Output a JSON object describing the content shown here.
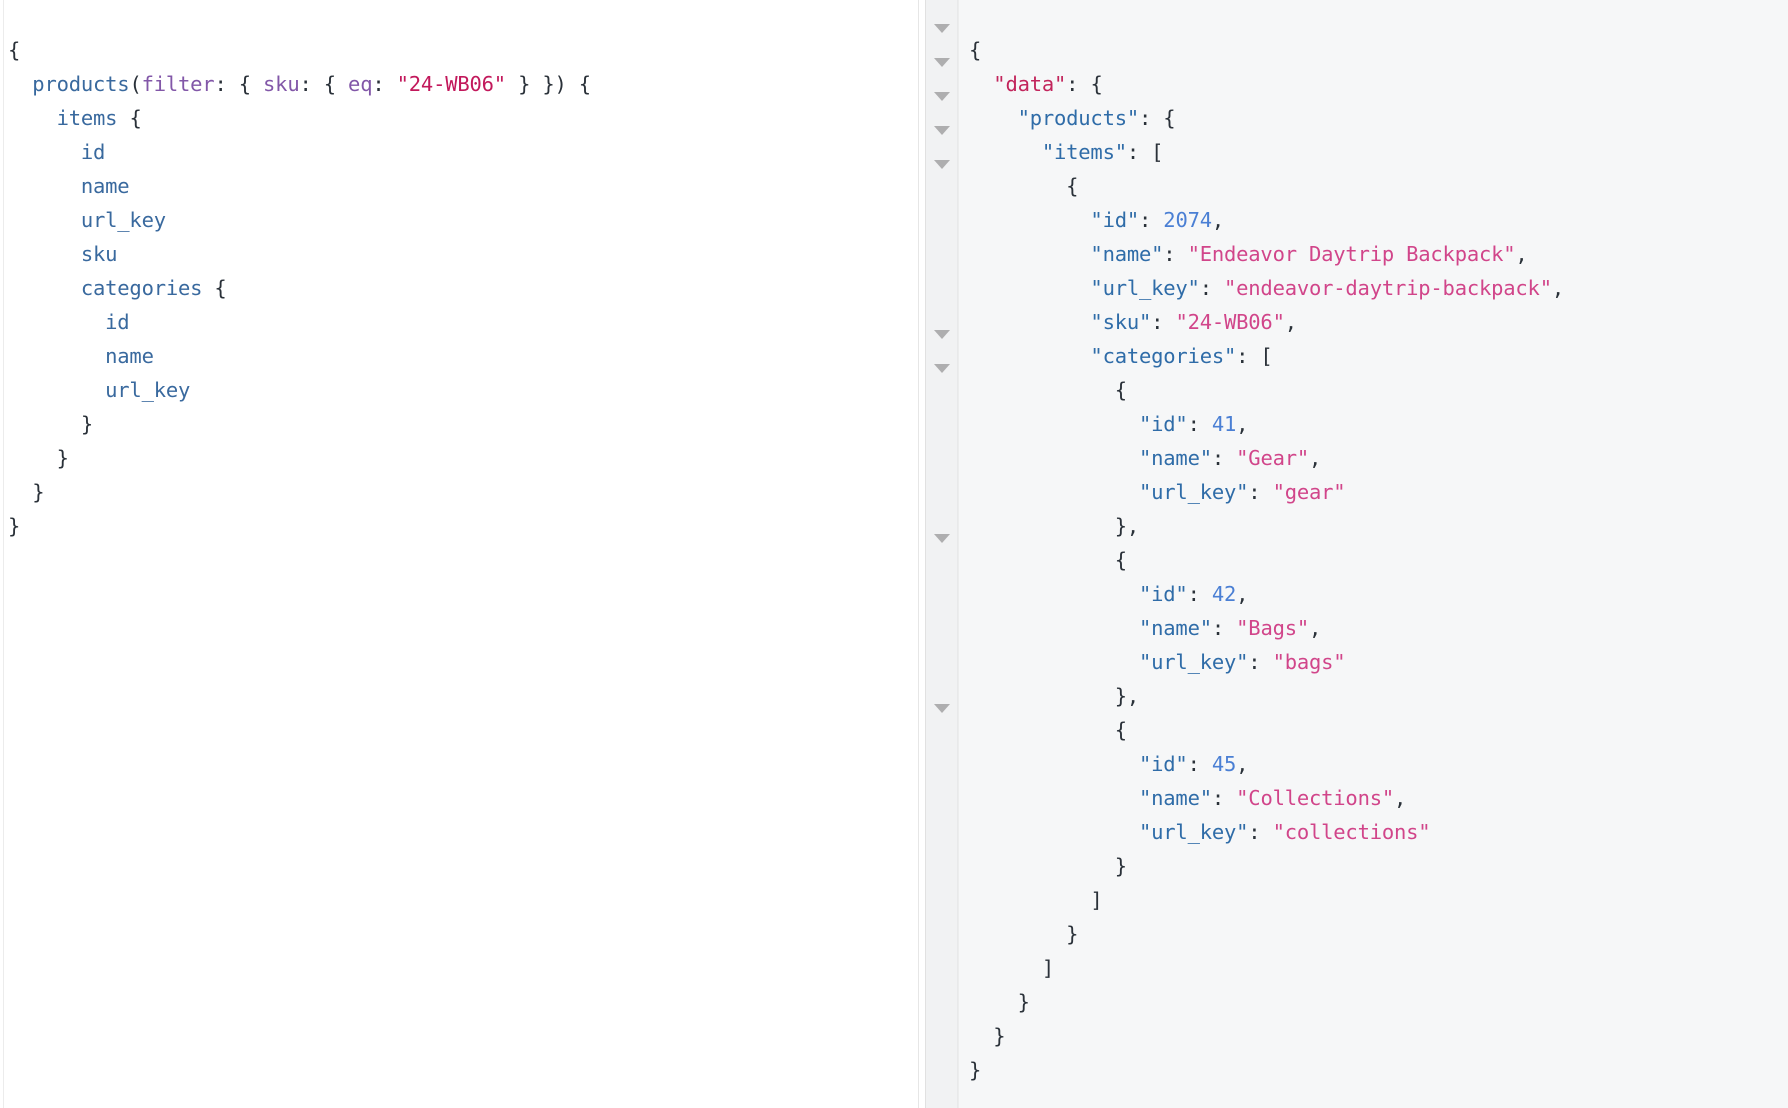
{
  "editor": {
    "name": "graphql-query-editor",
    "language": "graphql",
    "font_size_px": 20,
    "line_height_px": 34,
    "colors": {
      "punctuation": "#2a3139",
      "field": "#39699e",
      "argument": "#8257a8",
      "string": "#c2185b",
      "background": "#ffffff"
    },
    "query_text": "{\n  products(filter: { sku: { eq: \"24-WB06\" } }) {\n    items {\n      id\n      name\n      url_key\n      sku\n      categories {\n        id\n        name\n        url_key\n      }\n    }\n  }\n}",
    "lines": [
      {
        "indent": 0,
        "tokens": [
          {
            "t": "{",
            "c": "punc"
          }
        ]
      },
      {
        "indent": 1,
        "tokens": [
          {
            "t": "products",
            "c": "field"
          },
          {
            "t": "(",
            "c": "punc"
          },
          {
            "t": "filter",
            "c": "arg"
          },
          {
            "t": ": { ",
            "c": "punc"
          },
          {
            "t": "sku",
            "c": "arg"
          },
          {
            "t": ": { ",
            "c": "punc"
          },
          {
            "t": "eq",
            "c": "arg"
          },
          {
            "t": ": ",
            "c": "punc"
          },
          {
            "t": "\"24-WB06\"",
            "c": "str"
          },
          {
            "t": " } }) {",
            "c": "punc"
          }
        ]
      },
      {
        "indent": 2,
        "tokens": [
          {
            "t": "items",
            "c": "field"
          },
          {
            "t": " {",
            "c": "punc"
          }
        ]
      },
      {
        "indent": 3,
        "tokens": [
          {
            "t": "id",
            "c": "field"
          }
        ]
      },
      {
        "indent": 3,
        "tokens": [
          {
            "t": "name",
            "c": "field"
          }
        ]
      },
      {
        "indent": 3,
        "tokens": [
          {
            "t": "url_key",
            "c": "field"
          }
        ]
      },
      {
        "indent": 3,
        "tokens": [
          {
            "t": "sku",
            "c": "field"
          }
        ]
      },
      {
        "indent": 3,
        "tokens": [
          {
            "t": "categories",
            "c": "field"
          },
          {
            "t": " {",
            "c": "punc"
          }
        ]
      },
      {
        "indent": 4,
        "tokens": [
          {
            "t": "id",
            "c": "field"
          }
        ]
      },
      {
        "indent": 4,
        "tokens": [
          {
            "t": "name",
            "c": "field"
          }
        ]
      },
      {
        "indent": 4,
        "tokens": [
          {
            "t": "url_key",
            "c": "field"
          }
        ]
      },
      {
        "indent": 3,
        "tokens": [
          {
            "t": "}",
            "c": "punc"
          }
        ]
      },
      {
        "indent": 2,
        "tokens": [
          {
            "t": "}",
            "c": "punc"
          }
        ]
      },
      {
        "indent": 1,
        "tokens": [
          {
            "t": "}",
            "c": "punc"
          }
        ]
      },
      {
        "indent": 0,
        "tokens": [
          {
            "t": "}",
            "c": "punc"
          }
        ]
      }
    ]
  },
  "result": {
    "name": "graphql-response-viewer",
    "language": "json",
    "colors": {
      "punctuation": "#2a3139",
      "root_key": "#c2255c",
      "key": "#2f6ca8",
      "string": "#d1458a",
      "number": "#4a7fd4",
      "background": "#f6f7f8",
      "gutter_background": "#f1f2f3",
      "fold_arrow": "#9b9b9b"
    },
    "response_json": {
      "data": {
        "products": {
          "items": [
            {
              "id": 2074,
              "name": "Endeavor Daytrip Backpack",
              "url_key": "endeavor-daytrip-backpack",
              "sku": "24-WB06",
              "categories": [
                {
                  "id": 41,
                  "name": "Gear",
                  "url_key": "gear"
                },
                {
                  "id": 42,
                  "name": "Bags",
                  "url_key": "bags"
                },
                {
                  "id": 45,
                  "name": "Collections",
                  "url_key": "collections"
                }
              ]
            }
          ]
        }
      }
    },
    "fold_arrows": [
      {
        "name": "fold-arrow-root",
        "line": 0,
        "state": "expanded"
      },
      {
        "name": "fold-arrow-data",
        "line": 1,
        "state": "expanded"
      },
      {
        "name": "fold-arrow-products",
        "line": 2,
        "state": "expanded"
      },
      {
        "name": "fold-arrow-items",
        "line": 3,
        "state": "expanded"
      },
      {
        "name": "fold-arrow-item-0",
        "line": 4,
        "state": "expanded"
      },
      {
        "name": "fold-arrow-categories",
        "line": 9,
        "state": "expanded"
      },
      {
        "name": "fold-arrow-category-0",
        "line": 10,
        "state": "expanded"
      },
      {
        "name": "fold-arrow-category-1",
        "line": 15,
        "state": "expanded"
      },
      {
        "name": "fold-arrow-category-2",
        "line": 20,
        "state": "expanded"
      }
    ],
    "lines": [
      {
        "indent": 0,
        "tokens": [
          {
            "t": "{",
            "c": "punc"
          }
        ]
      },
      {
        "indent": 1,
        "tokens": [
          {
            "t": "\"data\"",
            "c": "rootkey"
          },
          {
            "t": ": {",
            "c": "punc"
          }
        ]
      },
      {
        "indent": 2,
        "tokens": [
          {
            "t": "\"products\"",
            "c": "key"
          },
          {
            "t": ": {",
            "c": "punc"
          }
        ]
      },
      {
        "indent": 3,
        "tokens": [
          {
            "t": "\"items\"",
            "c": "key"
          },
          {
            "t": ": [",
            "c": "punc"
          }
        ]
      },
      {
        "indent": 4,
        "tokens": [
          {
            "t": "{",
            "c": "punc"
          }
        ]
      },
      {
        "indent": 5,
        "tokens": [
          {
            "t": "\"id\"",
            "c": "key"
          },
          {
            "t": ": ",
            "c": "punc"
          },
          {
            "t": "2074",
            "c": "num"
          },
          {
            "t": ",",
            "c": "punc"
          }
        ]
      },
      {
        "indent": 5,
        "tokens": [
          {
            "t": "\"name\"",
            "c": "key"
          },
          {
            "t": ": ",
            "c": "punc"
          },
          {
            "t": "\"Endeavor Daytrip Backpack\"",
            "c": "str"
          },
          {
            "t": ",",
            "c": "punc"
          }
        ]
      },
      {
        "indent": 5,
        "tokens": [
          {
            "t": "\"url_key\"",
            "c": "key"
          },
          {
            "t": ": ",
            "c": "punc"
          },
          {
            "t": "\"endeavor-daytrip-backpack\"",
            "c": "str"
          },
          {
            "t": ",",
            "c": "punc"
          }
        ]
      },
      {
        "indent": 5,
        "tokens": [
          {
            "t": "\"sku\"",
            "c": "key"
          },
          {
            "t": ": ",
            "c": "punc"
          },
          {
            "t": "\"24-WB06\"",
            "c": "str"
          },
          {
            "t": ",",
            "c": "punc"
          }
        ]
      },
      {
        "indent": 5,
        "tokens": [
          {
            "t": "\"categories\"",
            "c": "key"
          },
          {
            "t": ": [",
            "c": "punc"
          }
        ]
      },
      {
        "indent": 6,
        "tokens": [
          {
            "t": "{",
            "c": "punc"
          }
        ]
      },
      {
        "indent": 7,
        "tokens": [
          {
            "t": "\"id\"",
            "c": "key"
          },
          {
            "t": ": ",
            "c": "punc"
          },
          {
            "t": "41",
            "c": "num"
          },
          {
            "t": ",",
            "c": "punc"
          }
        ]
      },
      {
        "indent": 7,
        "tokens": [
          {
            "t": "\"name\"",
            "c": "key"
          },
          {
            "t": ": ",
            "c": "punc"
          },
          {
            "t": "\"Gear\"",
            "c": "str"
          },
          {
            "t": ",",
            "c": "punc"
          }
        ]
      },
      {
        "indent": 7,
        "tokens": [
          {
            "t": "\"url_key\"",
            "c": "key"
          },
          {
            "t": ": ",
            "c": "punc"
          },
          {
            "t": "\"gear\"",
            "c": "str"
          }
        ]
      },
      {
        "indent": 6,
        "tokens": [
          {
            "t": "},",
            "c": "punc"
          }
        ]
      },
      {
        "indent": 6,
        "tokens": [
          {
            "t": "{",
            "c": "punc"
          }
        ]
      },
      {
        "indent": 7,
        "tokens": [
          {
            "t": "\"id\"",
            "c": "key"
          },
          {
            "t": ": ",
            "c": "punc"
          },
          {
            "t": "42",
            "c": "num"
          },
          {
            "t": ",",
            "c": "punc"
          }
        ]
      },
      {
        "indent": 7,
        "tokens": [
          {
            "t": "\"name\"",
            "c": "key"
          },
          {
            "t": ": ",
            "c": "punc"
          },
          {
            "t": "\"Bags\"",
            "c": "str"
          },
          {
            "t": ",",
            "c": "punc"
          }
        ]
      },
      {
        "indent": 7,
        "tokens": [
          {
            "t": "\"url_key\"",
            "c": "key"
          },
          {
            "t": ": ",
            "c": "punc"
          },
          {
            "t": "\"bags\"",
            "c": "str"
          }
        ]
      },
      {
        "indent": 6,
        "tokens": [
          {
            "t": "},",
            "c": "punc"
          }
        ]
      },
      {
        "indent": 6,
        "tokens": [
          {
            "t": "{",
            "c": "punc"
          }
        ]
      },
      {
        "indent": 7,
        "tokens": [
          {
            "t": "\"id\"",
            "c": "key"
          },
          {
            "t": ": ",
            "c": "punc"
          },
          {
            "t": "45",
            "c": "num"
          },
          {
            "t": ",",
            "c": "punc"
          }
        ]
      },
      {
        "indent": 7,
        "tokens": [
          {
            "t": "\"name\"",
            "c": "key"
          },
          {
            "t": ": ",
            "c": "punc"
          },
          {
            "t": "\"Collections\"",
            "c": "str"
          },
          {
            "t": ",",
            "c": "punc"
          }
        ]
      },
      {
        "indent": 7,
        "tokens": [
          {
            "t": "\"url_key\"",
            "c": "key"
          },
          {
            "t": ": ",
            "c": "punc"
          },
          {
            "t": "\"collections\"",
            "c": "str"
          }
        ]
      },
      {
        "indent": 6,
        "tokens": [
          {
            "t": "}",
            "c": "punc"
          }
        ]
      },
      {
        "indent": 5,
        "tokens": [
          {
            "t": "]",
            "c": "punc"
          }
        ]
      },
      {
        "indent": 4,
        "tokens": [
          {
            "t": "}",
            "c": "punc"
          }
        ]
      },
      {
        "indent": 3,
        "tokens": [
          {
            "t": "]",
            "c": "punc"
          }
        ]
      },
      {
        "indent": 2,
        "tokens": [
          {
            "t": "}",
            "c": "punc"
          }
        ]
      },
      {
        "indent": 1,
        "tokens": [
          {
            "t": "}",
            "c": "punc"
          }
        ]
      },
      {
        "indent": 0,
        "tokens": [
          {
            "t": "}",
            "c": "punc"
          }
        ]
      }
    ]
  }
}
